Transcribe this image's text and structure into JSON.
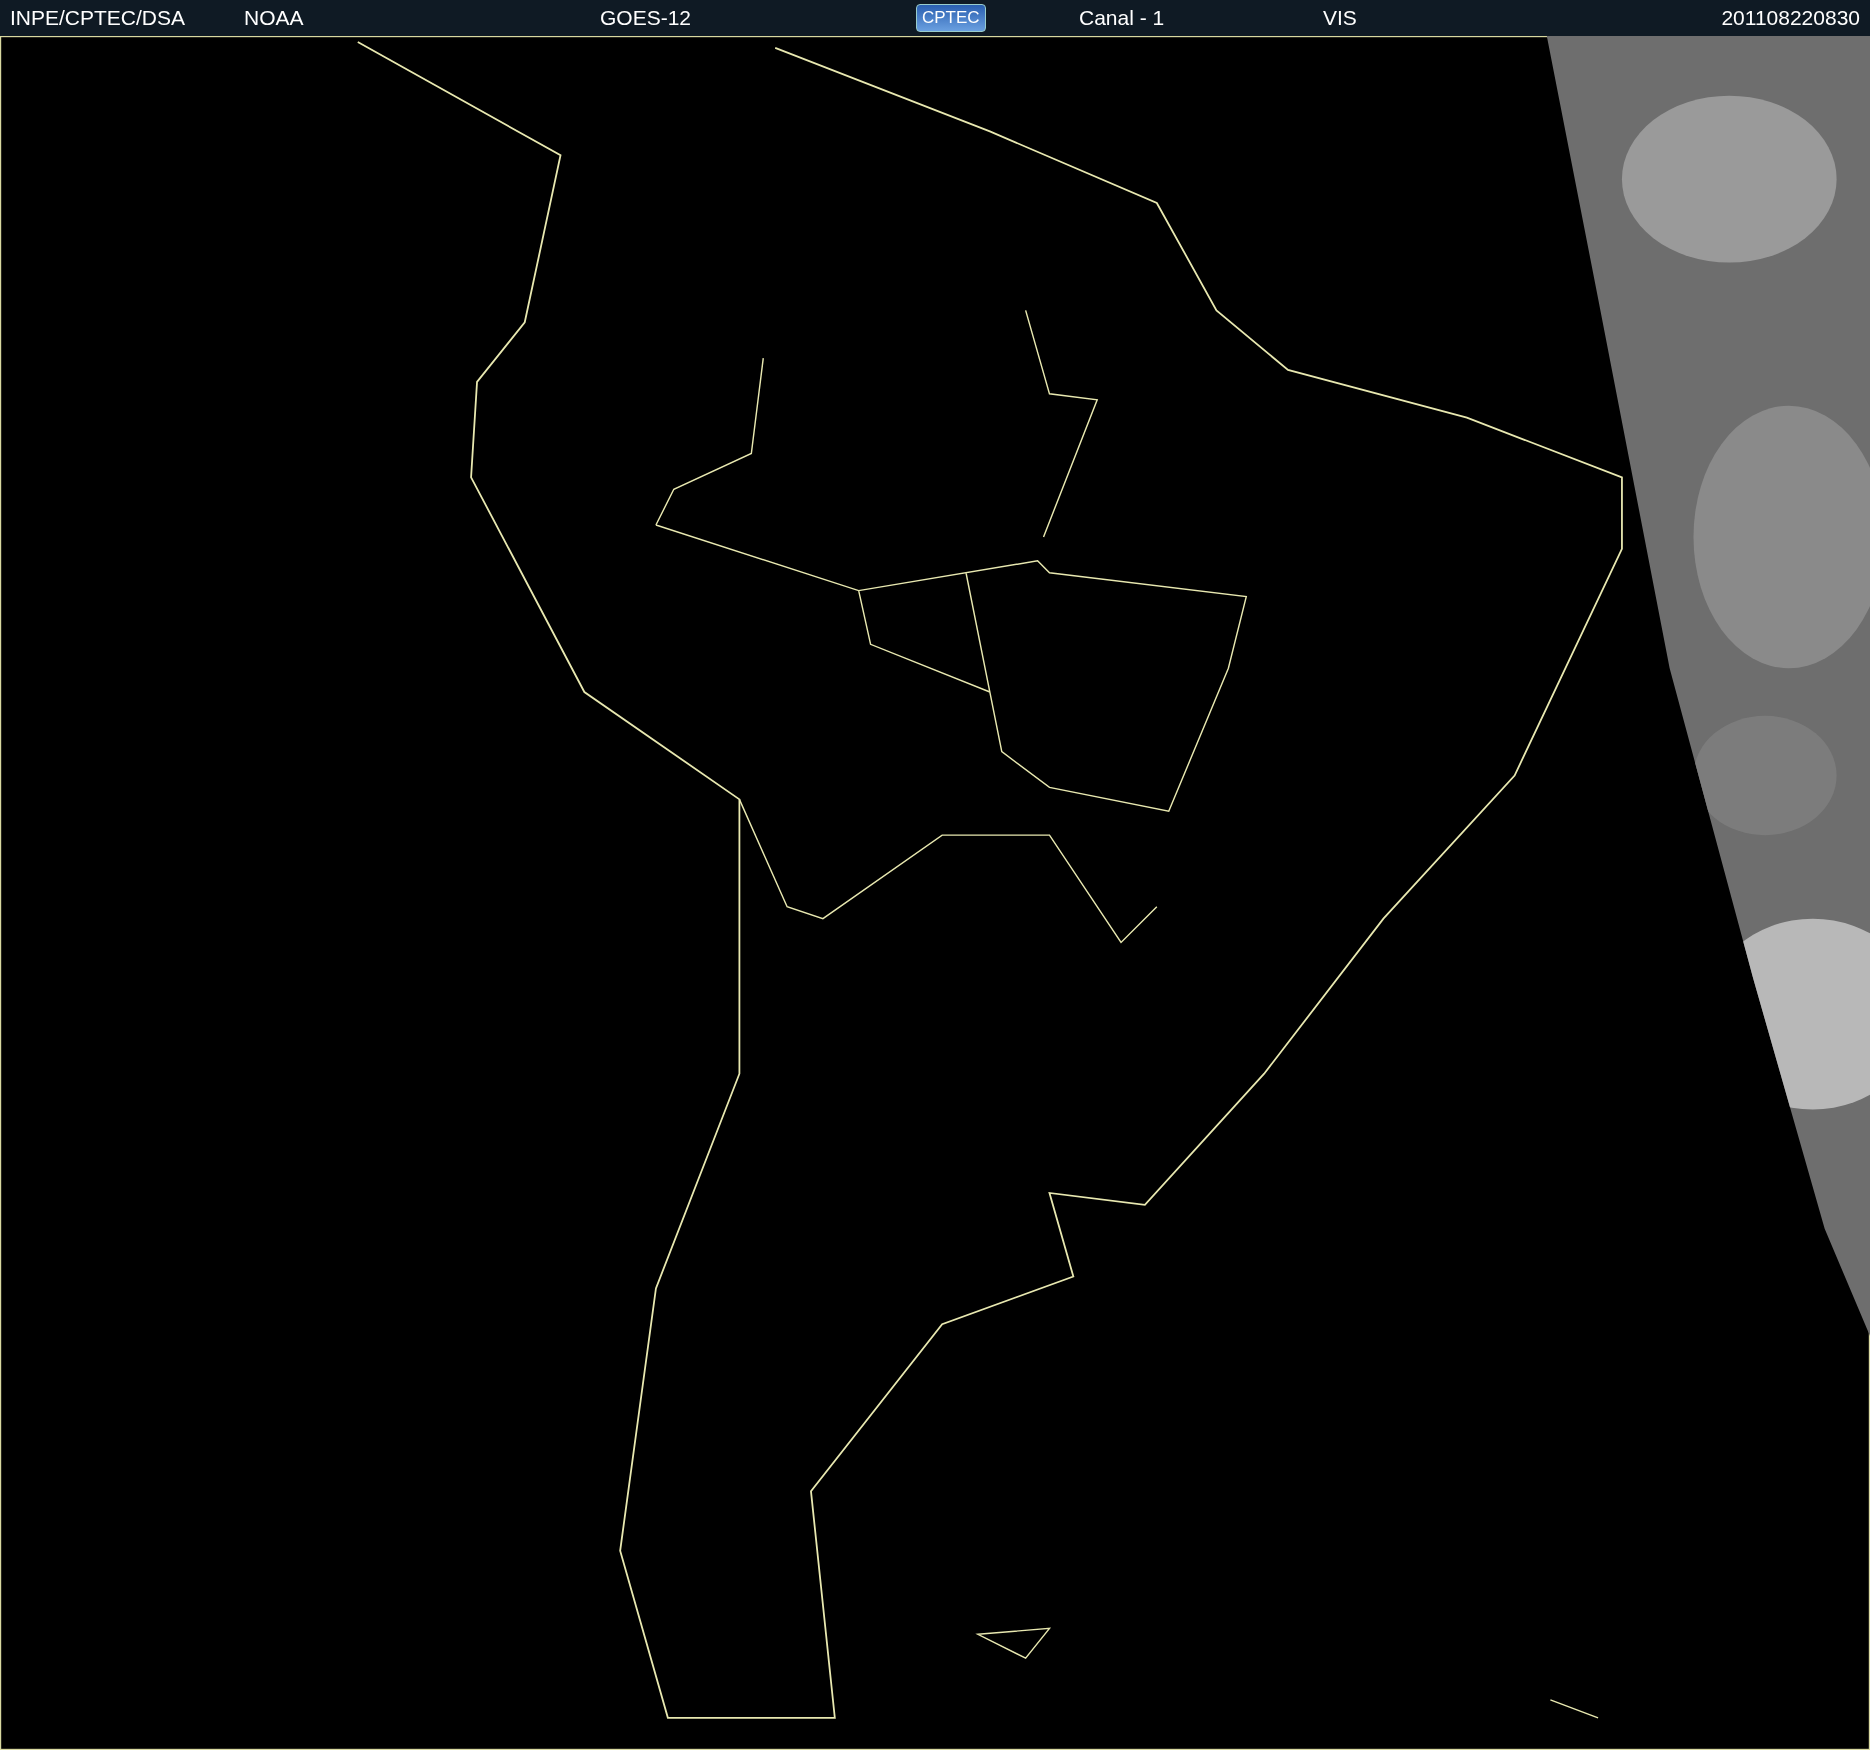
{
  "header": {
    "source": "INPE/CPTEC/DSA",
    "agency": "NOAA",
    "satellite": "GOES-12",
    "logo": "CPTEC",
    "channel": "Canal - 1",
    "band": "VIS",
    "timestamp": "201108220830"
  }
}
